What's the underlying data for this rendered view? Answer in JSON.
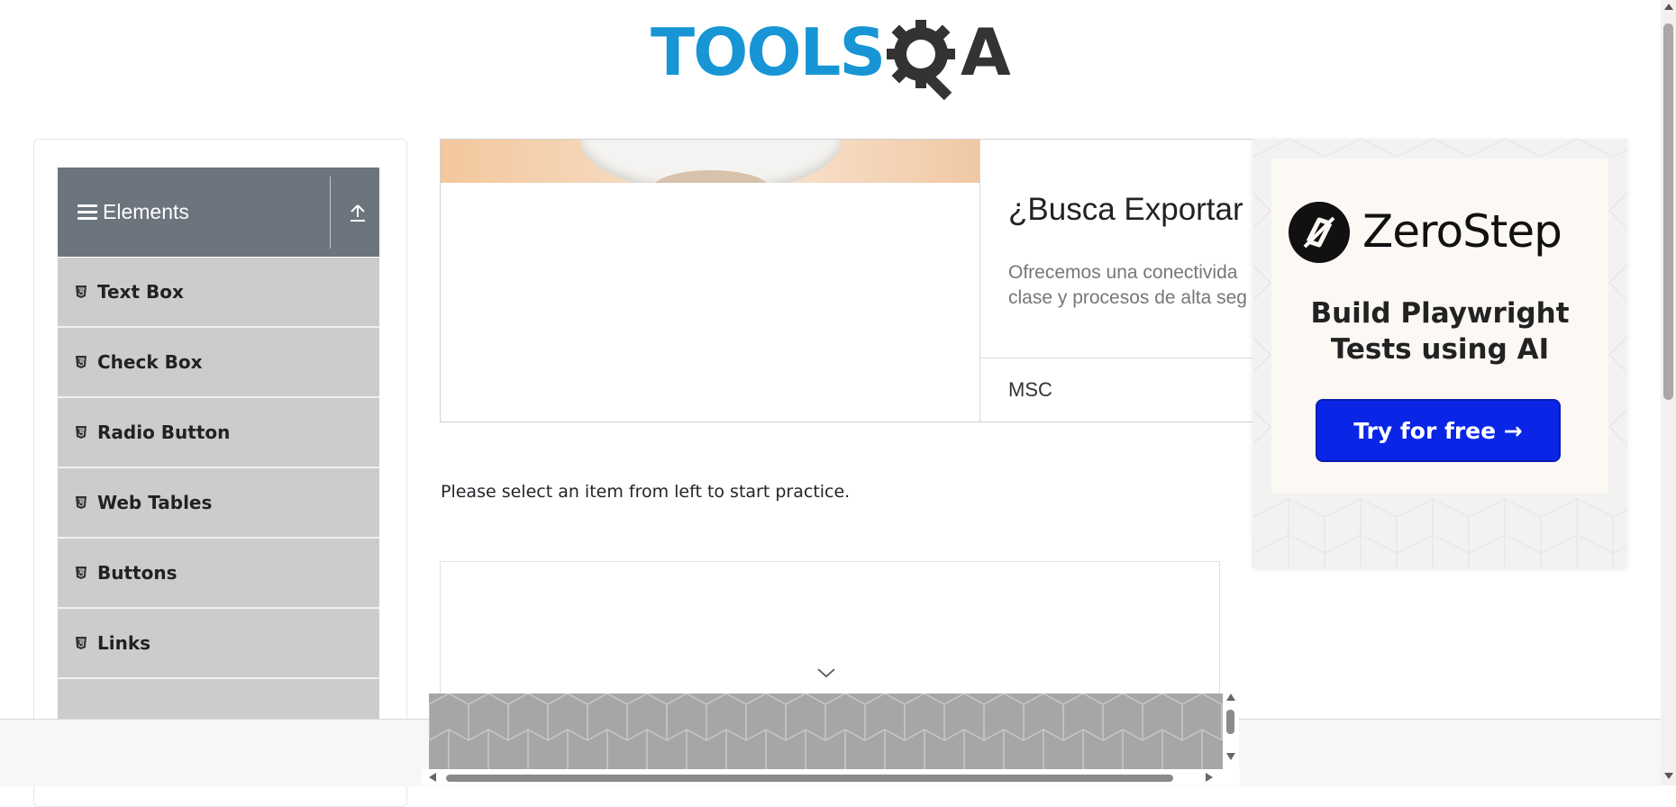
{
  "header": {
    "logo_text": "TOOLS",
    "logo_suffix": "A"
  },
  "sidebar": {
    "group_title": "Elements",
    "items": [
      {
        "label": "Text Box"
      },
      {
        "label": "Check Box"
      },
      {
        "label": "Radio Button"
      },
      {
        "label": "Web Tables"
      },
      {
        "label": "Buttons"
      },
      {
        "label": "Links"
      },
      {
        "label": ""
      }
    ]
  },
  "ad": {
    "title": "¿Busca Exportar",
    "body_line1": "Ofrecemos una conectivida",
    "body_line2": "clase y procesos de alta seg",
    "source": "MSC"
  },
  "zerostep_ad": {
    "brand": "ZeroStep",
    "tagline_line1": "Build Playwright",
    "tagline_line2": "Tests using AI",
    "cta": "Try for free →"
  },
  "main": {
    "instruction": "Please select an item from left to start practice."
  },
  "colors": {
    "logo_blue": "#1795d4",
    "sidebar_header": "#6c757d",
    "menu_item_bg": "#cccccc",
    "cta_blue": "#0a25e6"
  }
}
